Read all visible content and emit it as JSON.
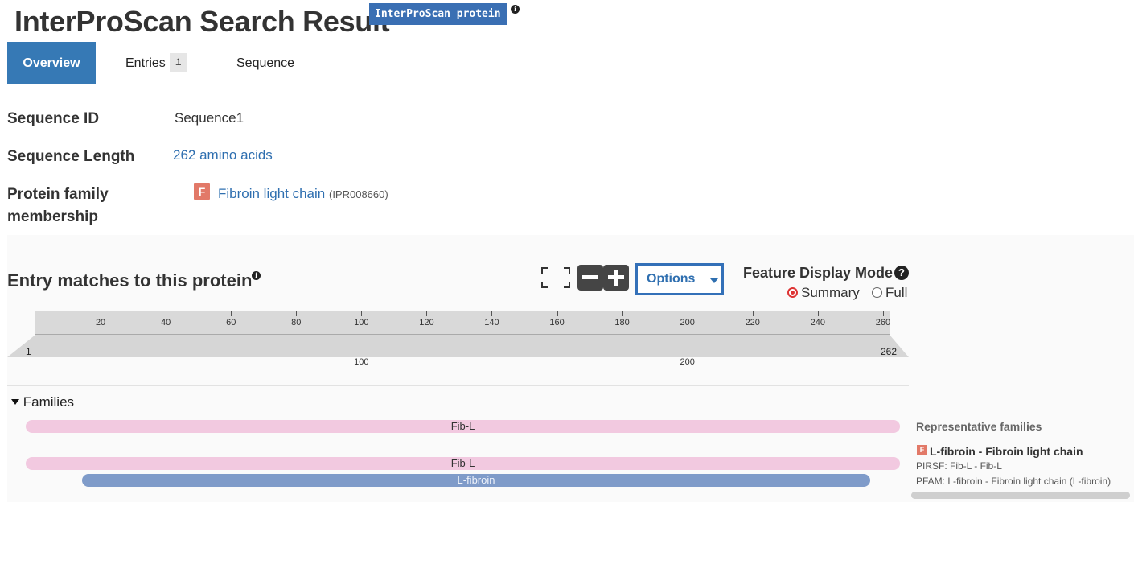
{
  "page": {
    "title": "InterProScan Search Result",
    "badge": "InterProScan protein",
    "info_glyph": "i"
  },
  "tabs": [
    {
      "label": "Overview",
      "active": true
    },
    {
      "label": "Entries",
      "count": "1"
    },
    {
      "label": "Sequence"
    }
  ],
  "summary": {
    "sequence_id_label": "Sequence ID",
    "sequence_id_value": "Sequence1",
    "sequence_length_label": "Sequence Length",
    "sequence_length_value": "262 amino acids",
    "family_label_line1": "Protein family",
    "family_label_line2": "membership",
    "family_icon": "F",
    "family_name": "Fibroin light chain",
    "family_accession": "(IPR008660)"
  },
  "entry_matches": {
    "title": "Entry matches to this protein",
    "options_label": "Options",
    "feature_display_mode_label": "Feature Display Mode",
    "help_glyph": "?",
    "modes": [
      {
        "label": "Summary",
        "selected": true
      },
      {
        "label": "Full",
        "selected": false
      }
    ]
  },
  "ruler": {
    "sequence_length": 262,
    "ticks": [
      "20",
      "40",
      "60",
      "80",
      "100",
      "120",
      "140",
      "160",
      "180",
      "200",
      "220",
      "240",
      "260"
    ],
    "start_label": "1",
    "end_label": "262",
    "bottom_labels": [
      "100",
      "200"
    ]
  },
  "tracks": {
    "section_label": "Families",
    "bars": [
      {
        "label": "Fib-L",
        "color": "#f2c9e0",
        "start": 1,
        "end": 262
      },
      {
        "label": "Fib-L",
        "color": "#f2c9e0",
        "start": 1,
        "end": 262
      },
      {
        "label": "L-fibroin",
        "color": "#7f9bc9",
        "start": 18,
        "end": 253
      }
    ]
  },
  "representative": {
    "title": "Representative families",
    "icon": "F",
    "entry_name": "L-fibroin - Fibroin light chain",
    "line1": "PIRSF: Fib-L - Fib-L",
    "line2": "PFAM: L-fibroin - Fibroin light chain (L-fibroin)"
  },
  "colors": {
    "accent": "#3679b5",
    "badge": "#3a6fb3",
    "family_icon": "#e27968",
    "link": "#2f6fb0"
  },
  "icons": {
    "info": "info-icon",
    "fullscreen": "fullscreen-icon",
    "zoom_out": "zoom-out-icon",
    "zoom_in": "zoom-in-icon",
    "dropdown": "caret-down-icon",
    "help": "help-icon",
    "collapse": "caret-down-icon"
  }
}
